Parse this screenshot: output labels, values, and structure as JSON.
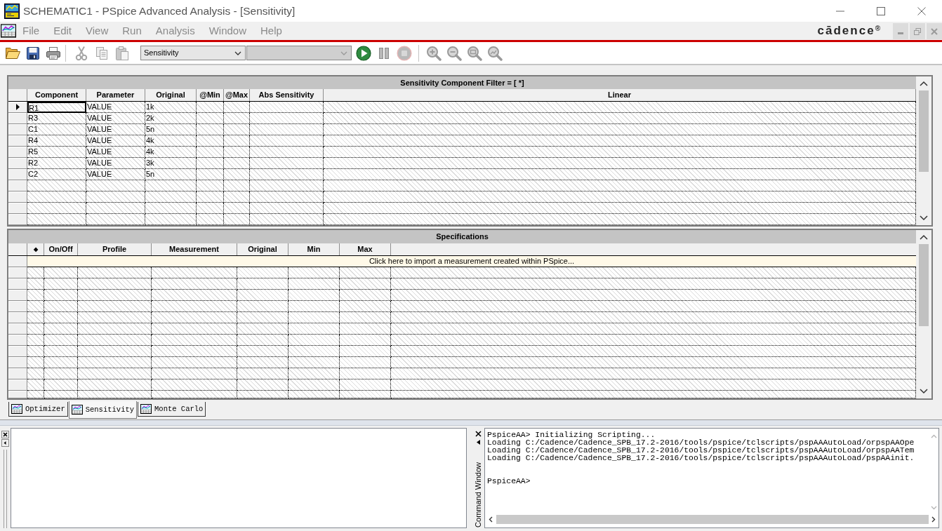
{
  "window": {
    "title": "SCHEMATIC1 - PSpice Advanced Analysis - [Sensitivity]"
  },
  "menu": [
    "File",
    "Edit",
    "View",
    "Run",
    "Analysis",
    "Window",
    "Help"
  ],
  "logo": {
    "text": "cādence$^{®}$"
  },
  "toolbar": {
    "file_buttons": [
      {
        "kind": "open",
        "disabled": false
      },
      {
        "kind": "save",
        "disabled": false
      },
      {
        "kind": "print",
        "disabled": false
      }
    ],
    "edit_buttons": [
      {
        "kind": "cut",
        "disabled": true
      },
      {
        "kind": "copy",
        "disabled": true
      },
      {
        "kind": "paste",
        "disabled": true
      }
    ],
    "analysis_select": {
      "value": "Sensitivity",
      "disabled": false
    },
    "second_select": {
      "disabled": true
    },
    "run_buttons": [
      {
        "kind": "run",
        "disabled": false
      },
      {
        "kind": "pause",
        "disabled": true
      },
      {
        "kind": "stop",
        "disabled": true
      }
    ],
    "zoom_buttons": [
      {
        "kind": "zoom_in",
        "disabled": true
      },
      {
        "kind": "zoom_out",
        "disabled": true
      },
      {
        "kind": "zoom_fit",
        "disabled": true
      },
      {
        "kind": "zoom_area",
        "disabled": true
      }
    ]
  },
  "sensitivity_table": {
    "title": "Sensitivity Component Filter = [ *]",
    "columns": [
      "Component",
      "Parameter",
      "Original",
      "@Min",
      "@Max",
      "Abs Sensitivity",
      "Linear"
    ],
    "rows": [
      {
        "selected": true,
        "cells": [
          "R1",
          "VALUE",
          "1k"
        ]
      },
      {
        "selected": false,
        "cells": [
          "R3",
          "VALUE",
          "2k"
        ]
      },
      {
        "selected": false,
        "cells": [
          "C1",
          "VALUE",
          "5n"
        ]
      },
      {
        "selected": false,
        "cells": [
          "R4",
          "VALUE",
          "4k"
        ]
      },
      {
        "selected": false,
        "cells": [
          "R5",
          "VALUE",
          "4k"
        ]
      },
      {
        "selected": false,
        "cells": [
          "R2",
          "VALUE",
          "3k"
        ]
      },
      {
        "selected": false,
        "cells": [
          "C2",
          "VALUE",
          "5n"
        ]
      }
    ]
  },
  "specifications_table": {
    "title": "Specifications",
    "columns": [
      "◆",
      "On/Off",
      "Profile",
      "Measurement",
      "Original",
      "Min",
      "Max"
    ],
    "import_row": "Click here to import a measurement created within PSpice..."
  },
  "tabs": [
    {
      "label": "Optimizer",
      "selected": false
    },
    {
      "label": "Sensitivity",
      "selected": true
    },
    {
      "label": "Monte Carlo",
      "selected": false
    }
  ],
  "command_window": {
    "title": "Command Window",
    "lines": [
      "PspiceAA> Initializing Scripting...",
      "Loading C:/Cadence/Cadence_SPB_17.2-2016/tools/pspice/tclscripts/pspAAAutoLoad/orpspAAOpe",
      "Loading C:/Cadence/Cadence_SPB_17.2-2016/tools/pspice/tclscripts/pspAAAutoLoad/orpspAATem",
      "Loading C:/Cadence/Cadence_SPB_17.2-2016/tools/pspice/tclscripts/pspAAAutoLoad/pspAAinit."
    ],
    "prompt": "PspiceAA>"
  }
}
